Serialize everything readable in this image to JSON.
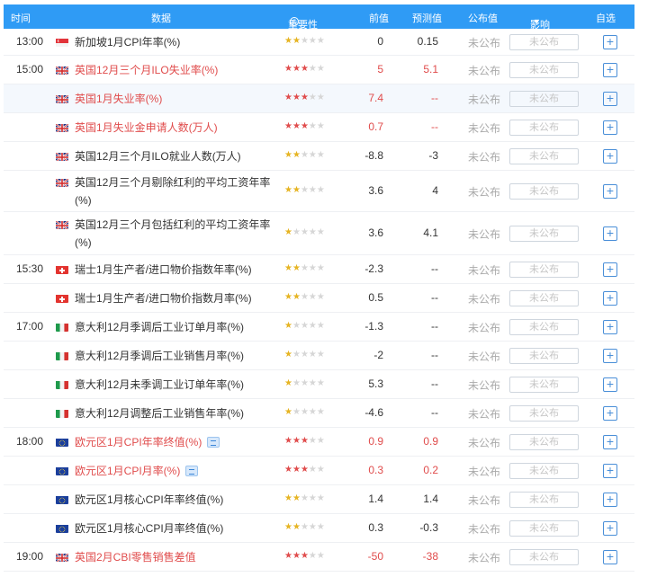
{
  "header": {
    "time": "时间",
    "data": "数据",
    "importance": "重要性",
    "previous": "前值",
    "forecast": "预测值",
    "published": "公布值",
    "influence": "影响",
    "watch": "自选"
  },
  "rows": [
    {
      "time": "13:00",
      "flag": "SG",
      "name": "新加坡1月CPI年率(%)",
      "red": false,
      "stars": 2,
      "prev": "0",
      "fore": "0.15",
      "pub": "未公布",
      "infl": "未公布"
    },
    {
      "time": "15:00",
      "flag": "GB",
      "name": "英国12月三个月ILO失业率(%)",
      "red": true,
      "stars": 3,
      "prev": "5",
      "fore": "5.1",
      "pub": "未公布",
      "infl": "未公布"
    },
    {
      "time": "",
      "flag": "GB",
      "name": "英国1月失业率(%)",
      "red": true,
      "stars": 3,
      "prev": "7.4",
      "fore": "--",
      "pub": "未公布",
      "infl": "未公布"
    },
    {
      "time": "",
      "flag": "GB",
      "name": "英国1月失业金申请人数(万人)",
      "red": true,
      "stars": 3,
      "prev": "0.7",
      "fore": "--",
      "pub": "未公布",
      "infl": "未公布"
    },
    {
      "time": "",
      "flag": "GB",
      "name": "英国12月三个月ILO就业人数(万人)",
      "red": false,
      "stars": 2,
      "prev": "-8.8",
      "fore": "-3",
      "pub": "未公布",
      "infl": "未公布"
    },
    {
      "time": "",
      "flag": "GB",
      "name": "英国12月三个月剔除红利的平均工资年率(%)",
      "red": false,
      "stars": 2,
      "prev": "3.6",
      "fore": "4",
      "pub": "未公布",
      "infl": "未公布"
    },
    {
      "time": "",
      "flag": "GB",
      "name": "英国12月三个月包括红利的平均工资年率(%)",
      "red": false,
      "stars": 1,
      "prev": "3.6",
      "fore": "4.1",
      "pub": "未公布",
      "infl": "未公布"
    },
    {
      "time": "15:30",
      "flag": "CH",
      "name": "瑞士1月生产者/进口物价指数年率(%)",
      "red": false,
      "stars": 2,
      "prev": "-2.3",
      "fore": "--",
      "pub": "未公布",
      "infl": "未公布"
    },
    {
      "time": "",
      "flag": "CH",
      "name": "瑞士1月生产者/进口物价指数月率(%)",
      "red": false,
      "stars": 2,
      "prev": "0.5",
      "fore": "--",
      "pub": "未公布",
      "infl": "未公布"
    },
    {
      "time": "17:00",
      "flag": "IT",
      "name": "意大利12月季调后工业订单月率(%)",
      "red": false,
      "stars": 1,
      "prev": "-1.3",
      "fore": "--",
      "pub": "未公布",
      "infl": "未公布"
    },
    {
      "time": "",
      "flag": "IT",
      "name": "意大利12月季调后工业销售月率(%)",
      "red": false,
      "stars": 1,
      "prev": "-2",
      "fore": "--",
      "pub": "未公布",
      "infl": "未公布"
    },
    {
      "time": "",
      "flag": "IT",
      "name": "意大利12月未季调工业订单年率(%)",
      "red": false,
      "stars": 1,
      "prev": "5.3",
      "fore": "--",
      "pub": "未公布",
      "infl": "未公布"
    },
    {
      "time": "",
      "flag": "IT",
      "name": "意大利12月调整后工业销售年率(%)",
      "red": false,
      "stars": 1,
      "prev": "-4.6",
      "fore": "--",
      "pub": "未公布",
      "infl": "未公布"
    },
    {
      "time": "18:00",
      "flag": "EU",
      "name": "欧元区1月CPI年率终值(%)",
      "red": true,
      "stars": 3,
      "prev": "0.9",
      "fore": "0.9",
      "pub": "未公布",
      "infl": "未公布",
      "doc": true
    },
    {
      "time": "",
      "flag": "EU",
      "name": "欧元区1月CPI月率(%)",
      "red": true,
      "stars": 3,
      "prev": "0.3",
      "fore": "0.2",
      "pub": "未公布",
      "infl": "未公布",
      "doc": true
    },
    {
      "time": "",
      "flag": "EU",
      "name": "欧元区1月核心CPI年率终值(%)",
      "red": false,
      "stars": 2,
      "prev": "1.4",
      "fore": "1.4",
      "pub": "未公布",
      "infl": "未公布"
    },
    {
      "time": "",
      "flag": "EU",
      "name": "欧元区1月核心CPI月率终值(%)",
      "red": false,
      "stars": 2,
      "prev": "0.3",
      "fore": "-0.3",
      "pub": "未公布",
      "infl": "未公布"
    },
    {
      "time": "19:00",
      "flag": "GB",
      "name": "英国2月CBI零售销售差值",
      "red": true,
      "stars": 3,
      "prev": "-50",
      "fore": "-38",
      "pub": "未公布",
      "infl": "未公布"
    }
  ],
  "colors": {
    "header_bg": "#2f9bf5",
    "highlight": "#e04c4c",
    "star_gold": "#e6b422",
    "star_off": "#d6d6d6"
  },
  "icons": {
    "add": "+",
    "info": "i",
    "caret": "▼"
  }
}
